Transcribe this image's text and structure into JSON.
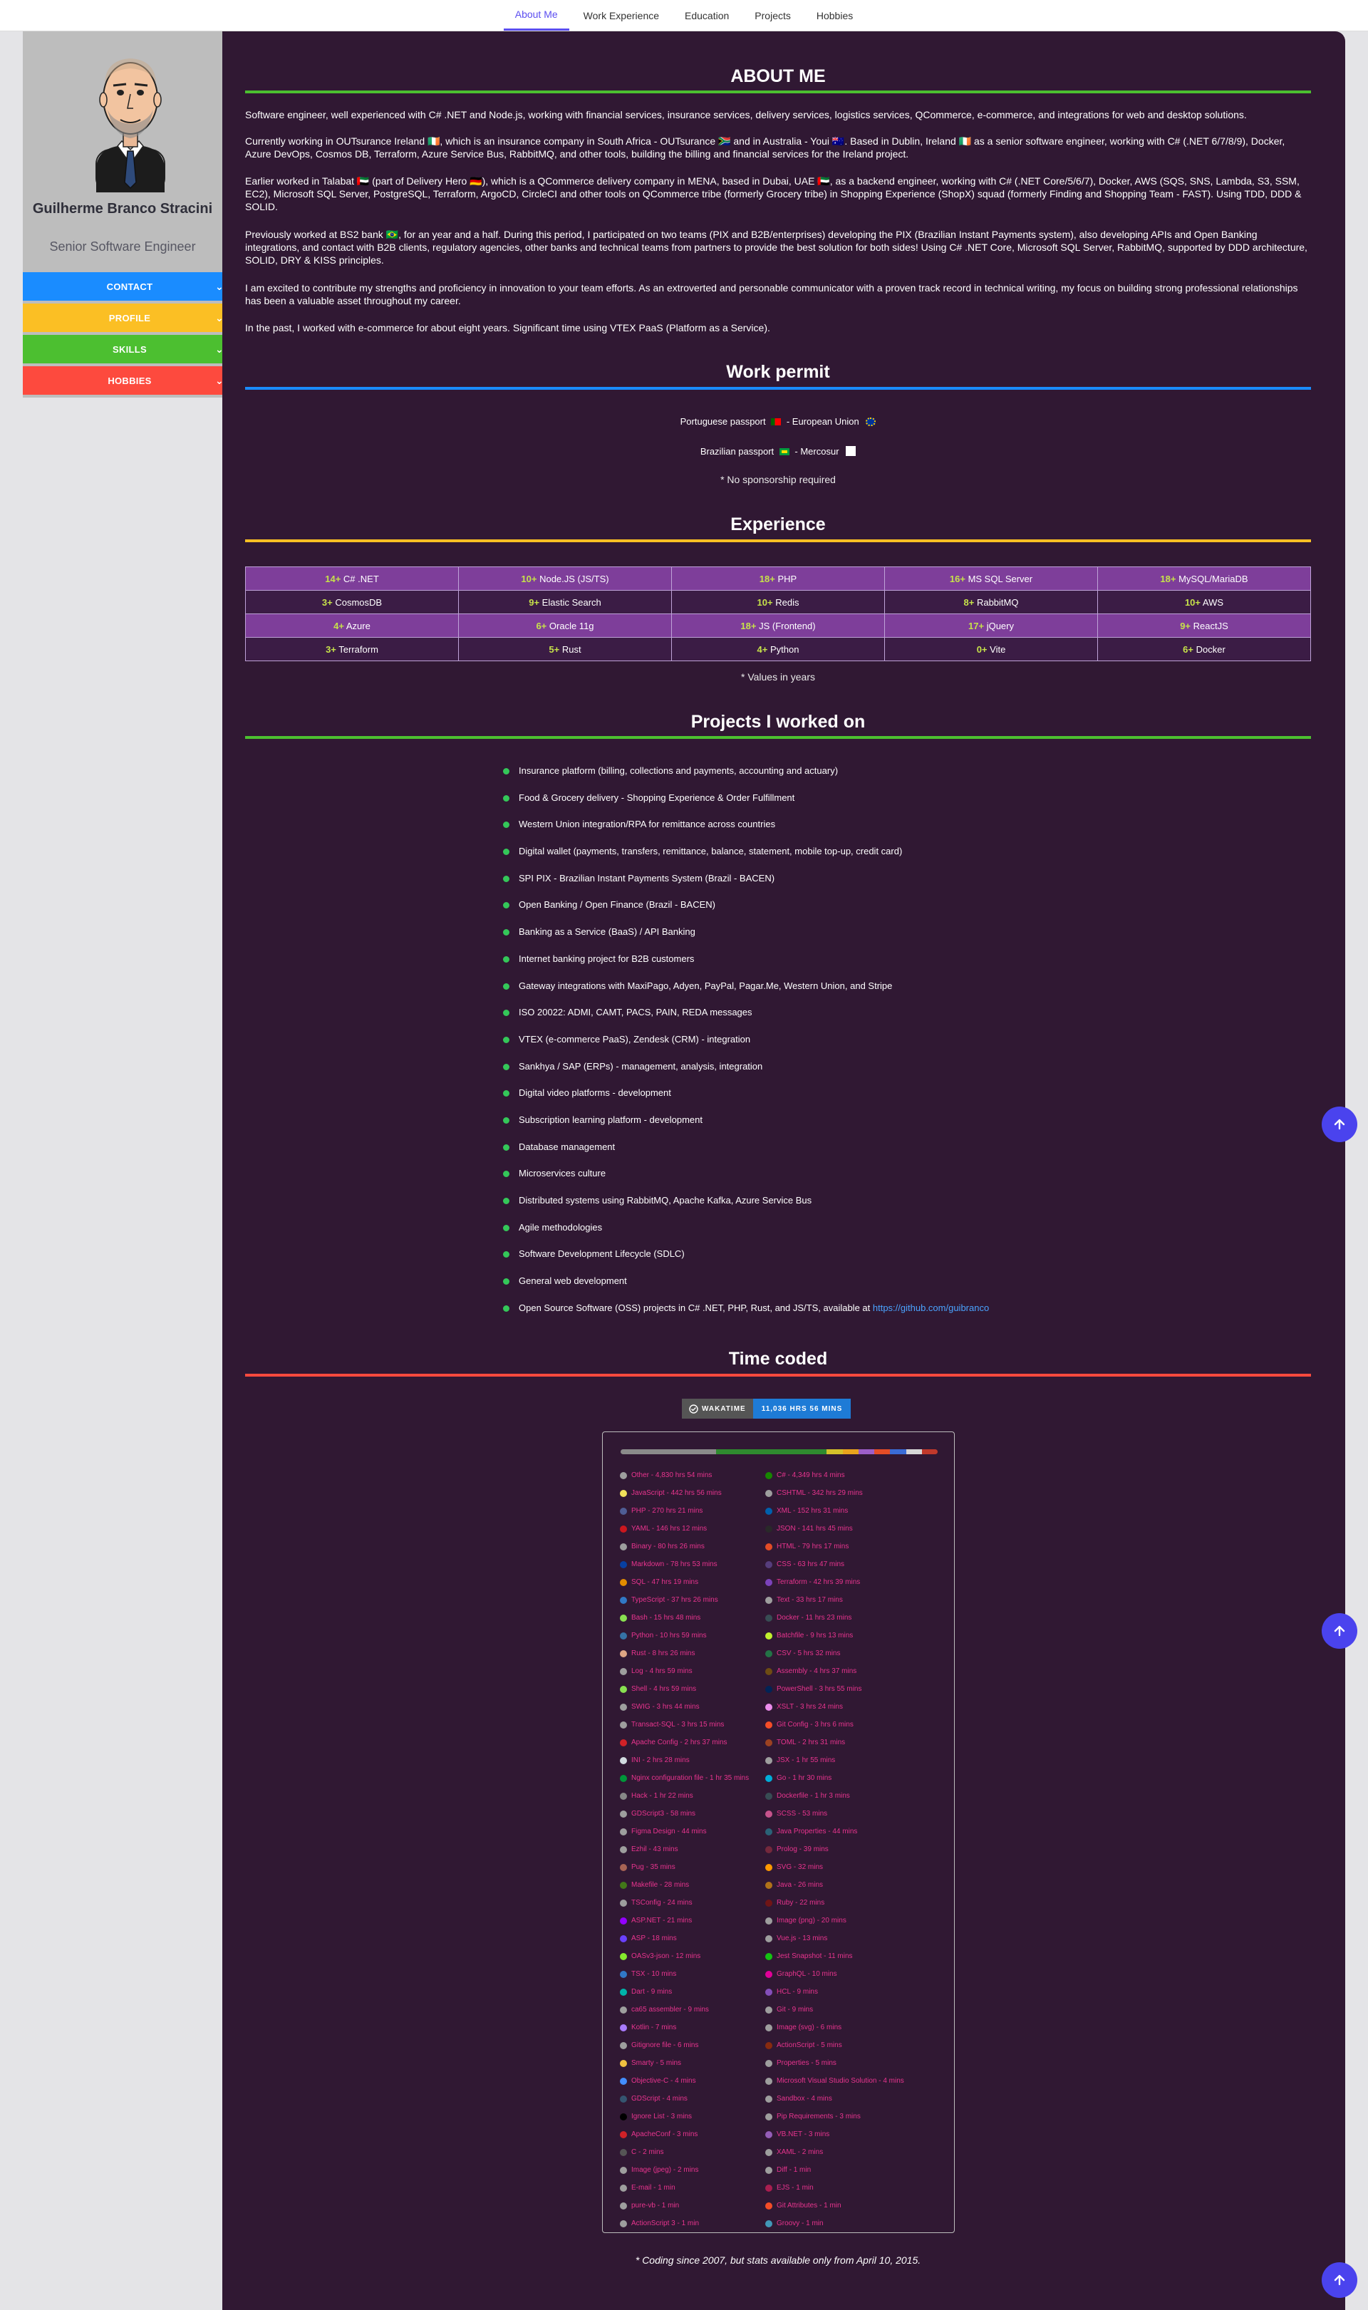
{
  "nav": {
    "tabs": [
      "About Me",
      "Work Experience",
      "Education",
      "Projects",
      "Hobbies"
    ],
    "active": "About Me"
  },
  "sidebar": {
    "name": "Guilherme Branco Stracini",
    "role": "Senior Software Engineer",
    "sections": [
      {
        "label": "CONTACT",
        "color": "#1a8cff"
      },
      {
        "label": "PROFILE",
        "color": "#fbbf24"
      },
      {
        "label": "SKILLS",
        "color": "#4cbf30"
      },
      {
        "label": "HOBBIES",
        "color": "#fd4a3e"
      }
    ]
  },
  "about": {
    "title": "ABOUT ME",
    "accent": "#4cbf30",
    "paragraphs": [
      "Software engineer, well experienced with C# .NET and Node.js, working with financial services, insurance services, delivery services, logistics services, QCommerce, e-commerce, and integrations for web and desktop solutions.",
      "Currently working in OUTsurance Ireland 🇮🇪, which is an insurance company in South Africa - OUTsurance 🇿🇦 and in Australia - Youi 🇦🇺. Based in Dublin, Ireland 🇮🇪 as a senior software engineer, working with C# (.NET 6/7/8/9), Docker, Azure DevOps, Cosmos DB, Terraform, Azure Service Bus, RabbitMQ, and other tools, building the billing and financial services for the Ireland project.",
      "Earlier worked in Talabat 🇦🇪 (part of Delivery Hero 🇩🇪), which is a QCommerce delivery company in MENA, based in Dubai, UAE 🇦🇪, as a backend engineer, working with C# (.NET Core/5/6/7), Docker, AWS (SQS, SNS, Lambda, S3, SSM, EC2), Microsoft SQL Server, PostgreSQL, Terraform, ArgoCD, CircleCI and other tools on QCommerce tribe (formerly Grocery tribe) in Shopping Experience (ShopX) squad (formerly Finding and Shopping Team - FAST). Using TDD, DDD & SOLID.",
      "Previously worked at BS2 bank 🇧🇷, for an year and a half. During this period, I participated on two teams (PIX and B2B/enterprises) developing the PIX (Brazilian Instant Payments system), also developing APIs and Open Banking integrations, and contact with B2B clients, regulatory agencies, other banks and technical teams from partners to provide the best solution for both sides! Using C# .NET Core, Microsoft SQL Server, RabbitMQ, supported by DDD architecture, SOLID, DRY & KISS principles.",
      "I am excited to contribute my strengths and proficiency in innovation to your team efforts. As an extroverted and personable communicator with a proven track record in technical writing, my focus on building strong professional relationships has been a valuable asset throughout my career.",
      "In the past, I worked with e-commerce for about eight years. Significant time using VTEX PaaS (Platform as a Service)."
    ]
  },
  "permit": {
    "title": "Work permit",
    "accent": "#1a8cff",
    "lines": [
      {
        "passport": "Portuguese passport",
        "union": "European Union"
      },
      {
        "passport": "Brazilian passport",
        "union": "Mercosur"
      }
    ],
    "note": "* No sponsorship required"
  },
  "experience": {
    "title": "Experience",
    "accent": "#fbbf24",
    "rows": [
      [
        {
          "y": "14+",
          "s": "C# .NET"
        },
        {
          "y": "10+",
          "s": "Node.JS (JS/TS)"
        },
        {
          "y": "18+",
          "s": "PHP"
        },
        {
          "y": "16+",
          "s": "MS SQL Server"
        },
        {
          "y": "18+",
          "s": "MySQL/MariaDB"
        }
      ],
      [
        {
          "y": "3+",
          "s": "CosmosDB"
        },
        {
          "y": "9+",
          "s": "Elastic Search"
        },
        {
          "y": "10+",
          "s": "Redis"
        },
        {
          "y": "8+",
          "s": "RabbitMQ"
        },
        {
          "y": "10+",
          "s": "AWS"
        }
      ],
      [
        {
          "y": "4+",
          "s": "Azure"
        },
        {
          "y": "6+",
          "s": "Oracle 11g"
        },
        {
          "y": "18+",
          "s": "JS (Frontend)"
        },
        {
          "y": "17+",
          "s": "jQuery"
        },
        {
          "y": "9+",
          "s": "ReactJS"
        }
      ],
      [
        {
          "y": "3+",
          "s": "Terraform"
        },
        {
          "y": "5+",
          "s": "Rust"
        },
        {
          "y": "4+",
          "s": "Python"
        },
        {
          "y": "0+",
          "s": "Vite"
        },
        {
          "y": "6+",
          "s": "Docker"
        }
      ]
    ],
    "note": "* Values in years"
  },
  "projects": {
    "title": "Projects I worked on",
    "accent": "#4cbf30",
    "items": [
      "Insurance platform (billing, collections and payments, accounting and actuary)",
      "Food & Grocery delivery - Shopping Experience & Order Fulfillment",
      "Western Union integration/RPA for remittance across countries",
      "Digital wallet (payments, transfers, remittance, balance, statement, mobile top-up, credit card)",
      "SPI PIX - Brazilian Instant Payments System (Brazil - BACEN)",
      "Open Banking / Open Finance (Brazil - BACEN)",
      "Banking as a Service (BaaS) / API Banking",
      "Internet banking project for B2B customers",
      "Gateway integrations with MaxiPago, Adyen, PayPal, Pagar.Me, Western Union, and Stripe",
      "ISO 20022: ADMI, CAMT, PACS, PAIN, REDA messages",
      "VTEX (e-commerce PaaS), Zendesk (CRM) - integration",
      "Sankhya / SAP (ERPs) - management, analysis, integration",
      "Digital video platforms - development",
      "Subscription learning platform - development",
      "Database management",
      "Microservices culture",
      "Distributed systems using RabbitMQ, Apache Kafka, Azure Service Bus",
      "Agile methodologies",
      "Software Development Lifecycle (SDLC)",
      "General web development"
    ],
    "oss_text": "Open Source Software (OSS) projects in C# .NET, PHP, Rust, and JS/TS, available at ",
    "oss_link": "https://github.com/guibranco"
  },
  "time": {
    "title": "Time coded",
    "accent": "#fd4a3e",
    "badge_label": "WAKATIME",
    "badge_value": "11,036 HRS 56 MINS",
    "bar_colors": [
      "#8a8a8a",
      "#8a8a8a",
      "#8a8a8a",
      "#8a8a8a",
      "#8a8a8a",
      "#8a8a8a",
      "#2f8a2f",
      "#2f8a2f",
      "#2f8a2f",
      "#2f8a2f",
      "#2f8a2f",
      "#2f8a2f",
      "#2f8a2f",
      "#d4c12a",
      "#e8a41d",
      "#9d5ec8",
      "#e44d26",
      "#3a6cd6",
      "#d6d6d6",
      "#c0392b"
    ],
    "left": [
      {
        "t": "Other - 4,830 hrs 54 mins",
        "c": "#9e9e9e"
      },
      {
        "t": "JavaScript - 442 hrs 56 mins",
        "c": "#f1e05a"
      },
      {
        "t": "PHP - 270 hrs 21 mins",
        "c": "#4f5d95"
      },
      {
        "t": "YAML - 146 hrs 12 mins",
        "c": "#cb171e"
      },
      {
        "t": "Binary - 80 hrs 26 mins",
        "c": "#9e9e9e"
      },
      {
        "t": "Markdown - 78 hrs 53 mins",
        "c": "#083fa1"
      },
      {
        "t": "SQL - 47 hrs 19 mins",
        "c": "#e38c00"
      },
      {
        "t": "TypeScript - 37 hrs 26 mins",
        "c": "#3178c6"
      },
      {
        "t": "Bash - 15 hrs 48 mins",
        "c": "#89e051"
      },
      {
        "t": "Python - 10 hrs 59 mins",
        "c": "#3572a5"
      },
      {
        "t": "Rust - 8 hrs 26 mins",
        "c": "#dea584"
      },
      {
        "t": "Log - 4 hrs 59 mins",
        "c": "#9e9e9e"
      },
      {
        "t": "Shell - 4 hrs 59 mins",
        "c": "#89e051"
      },
      {
        "t": "SWIG - 3 hrs 44 mins",
        "c": "#9e9e9e"
      },
      {
        "t": "Transact-SQL - 3 hrs 15 mins",
        "c": "#9e9e9e"
      },
      {
        "t": "Apache Config - 2 hrs 37 mins",
        "c": "#d12127"
      },
      {
        "t": "INI - 2 hrs 28 mins",
        "c": "#d1dbe0"
      },
      {
        "t": "Nginx configuration file - 1 hr 35 mins",
        "c": "#009639"
      },
      {
        "t": "Hack - 1 hr 22 mins",
        "c": "#878787"
      },
      {
        "t": "GDScript3 - 58 mins",
        "c": "#9e9e9e"
      },
      {
        "t": "Figma Design - 44 mins",
        "c": "#9e9e9e"
      },
      {
        "t": "Ezhil - 43 mins",
        "c": "#9e9e9e"
      },
      {
        "t": "Pug - 35 mins",
        "c": "#a86454"
      },
      {
        "t": "Makefile - 28 mins",
        "c": "#427819"
      },
      {
        "t": "TSConfig - 24 mins",
        "c": "#9e9e9e"
      },
      {
        "t": "ASP.NET - 21 mins",
        "c": "#9400ff"
      },
      {
        "t": "ASP - 18 mins",
        "c": "#6a40fd"
      },
      {
        "t": "OASv3-json - 12 mins",
        "c": "#85ea2d"
      },
      {
        "t": "TSX - 10 mins",
        "c": "#3178c6"
      },
      {
        "t": "Dart - 9 mins",
        "c": "#00b4ab"
      },
      {
        "t": "ca65 assembler - 9 mins",
        "c": "#9e9e9e"
      },
      {
        "t": "Kotlin - 7 mins",
        "c": "#a97bff"
      },
      {
        "t": "Gitignore file - 6 mins",
        "c": "#9e9e9e"
      },
      {
        "t": "Smarty - 5 mins",
        "c": "#f0c040"
      },
      {
        "t": "Objective-C - 4 mins",
        "c": "#438eff"
      },
      {
        "t": "GDScript - 4 mins",
        "c": "#355570"
      },
      {
        "t": "Ignore List - 3 mins",
        "c": "#000000"
      },
      {
        "t": "ApacheConf - 3 mins",
        "c": "#d12127"
      },
      {
        "t": "C - 2 mins",
        "c": "#555555"
      },
      {
        "t": "Image (jpeg) - 2 mins",
        "c": "#9e9e9e"
      },
      {
        "t": "E-mail - 1 min",
        "c": "#9e9e9e"
      },
      {
        "t": "pure-vb - 1 min",
        "c": "#9e9e9e"
      },
      {
        "t": "ActionScript 3 - 1 min",
        "c": "#9e9e9e"
      }
    ],
    "right": [
      {
        "t": "C# - 4,349 hrs 4 mins",
        "c": "#178600"
      },
      {
        "t": "CSHTML - 342 hrs 29 mins",
        "c": "#9e9e9e"
      },
      {
        "t": "XML - 152 hrs 31 mins",
        "c": "#0060ac"
      },
      {
        "t": "JSON - 141 hrs 45 mins",
        "c": "#292929"
      },
      {
        "t": "HTML - 79 hrs 17 mins",
        "c": "#e34c26"
      },
      {
        "t": "CSS - 63 hrs 47 mins",
        "c": "#563d7c"
      },
      {
        "t": "Terraform - 42 hrs 39 mins",
        "c": "#7b42bb"
      },
      {
        "t": "Text - 33 hrs 17 mins",
        "c": "#9e9e9e"
      },
      {
        "t": "Docker - 11 hrs 23 mins",
        "c": "#384d54"
      },
      {
        "t": "Batchfile - 9 hrs 13 mins",
        "c": "#c1f12e"
      },
      {
        "t": "CSV - 5 hrs 32 mins",
        "c": "#237346"
      },
      {
        "t": "Assembly - 4 hrs 37 mins",
        "c": "#6e4c13"
      },
      {
        "t": "PowerShell - 3 hrs 55 mins",
        "c": "#012456"
      },
      {
        "t": "XSLT - 3 hrs 24 mins",
        "c": "#eb8ceb"
      },
      {
        "t": "Git Config - 3 hrs 6 mins",
        "c": "#f44d27"
      },
      {
        "t": "TOML - 2 hrs 31 mins",
        "c": "#9c4221"
      },
      {
        "t": "JSX - 1 hr 55 mins",
        "c": "#9e9e9e"
      },
      {
        "t": "Go - 1 hr 30 mins",
        "c": "#00add8"
      },
      {
        "t": "Dockerfile - 1 hr 3 mins",
        "c": "#384d54"
      },
      {
        "t": "SCSS - 53 mins",
        "c": "#c6538c"
      },
      {
        "t": "Java Properties - 44 mins",
        "c": "#2a6277"
      },
      {
        "t": "Prolog - 39 mins",
        "c": "#74283c"
      },
      {
        "t": "SVG - 32 mins",
        "c": "#ff9900"
      },
      {
        "t": "Java - 26 mins",
        "c": "#b07219"
      },
      {
        "t": "Ruby - 22 mins",
        "c": "#701516"
      },
      {
        "t": "Image (png) - 20 mins",
        "c": "#9e9e9e"
      },
      {
        "t": "Vue.js - 13 mins",
        "c": "#9e9e9e"
      },
      {
        "t": "Jest Snapshot - 11 mins",
        "c": "#15c213"
      },
      {
        "t": "GraphQL - 10 mins",
        "c": "#e10098"
      },
      {
        "t": "HCL - 9 mins",
        "c": "#844fba"
      },
      {
        "t": "Git - 9 mins",
        "c": "#9e9e9e"
      },
      {
        "t": "Image (svg) - 6 mins",
        "c": "#9e9e9e"
      },
      {
        "t": "ActionScript - 5 mins",
        "c": "#882b0f"
      },
      {
        "t": "Properties - 5 mins",
        "c": "#9e9e9e"
      },
      {
        "t": "Microsoft Visual Studio Solution - 4 mins",
        "c": "#9e9e9e"
      },
      {
        "t": "Sandbox - 4 mins",
        "c": "#9e9e9e"
      },
      {
        "t": "Pip Requirements - 3 mins",
        "c": "#9e9e9e"
      },
      {
        "t": "VB.NET - 3 mins",
        "c": "#945db7"
      },
      {
        "t": "XAML - 2 mins",
        "c": "#9e9e9e"
      },
      {
        "t": "Diff - 1 min",
        "c": "#9e9e9e"
      },
      {
        "t": "EJS - 1 min",
        "c": "#a91e50"
      },
      {
        "t": "Git Attributes - 1 min",
        "c": "#f44d27"
      },
      {
        "t": "Groovy - 1 min",
        "c": "#4298b8"
      }
    ],
    "footnote": "* Coding since 2007, but stats available only from April 10, 2015."
  }
}
